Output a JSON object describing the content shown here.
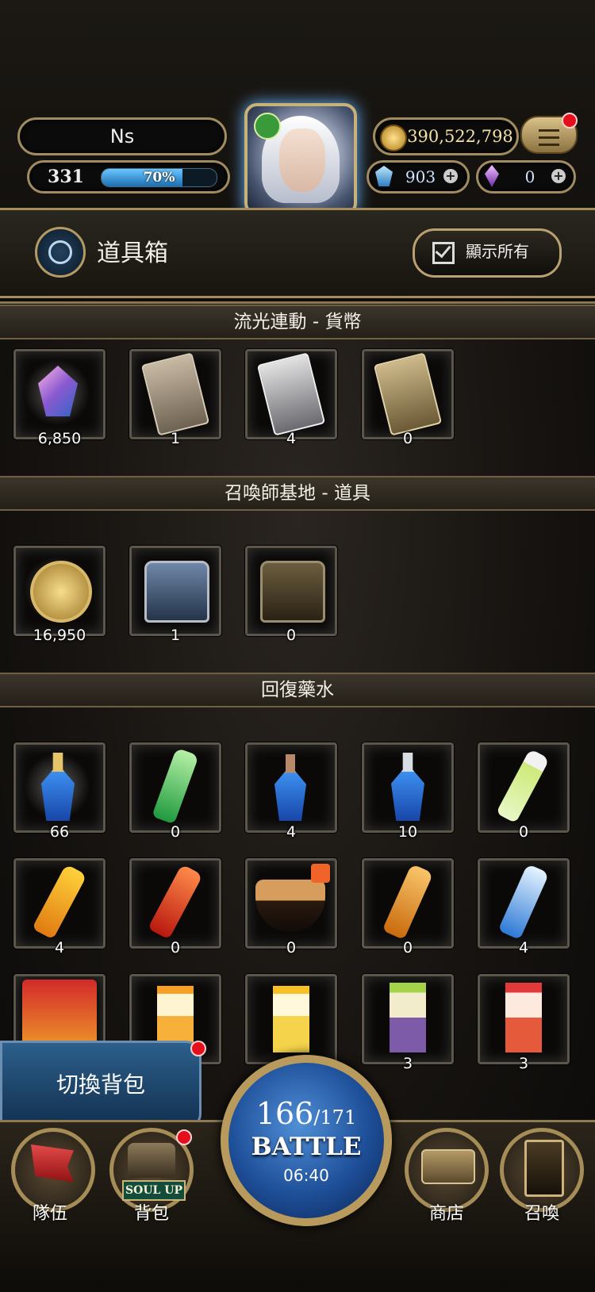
{
  "header": {
    "player_name": "Ns",
    "level": "331",
    "xp_percent_label": "70%",
    "xp_fraction": 0.7,
    "gold": "390,522,798",
    "gems": "903",
    "crystals": "0"
  },
  "item_box": {
    "title": "道具箱",
    "show_all_label": "顯示所有"
  },
  "sections": [
    {
      "title": "流光連動 - 貨幣",
      "items": [
        {
          "icon": "crystal-gem-icon",
          "count": "6,850"
        },
        {
          "icon": "bronze-card-icon",
          "count": "1"
        },
        {
          "icon": "silver-card-icon",
          "count": "4"
        },
        {
          "icon": "gold-card-icon",
          "count": "0"
        }
      ]
    },
    {
      "title": "召喚師基地 - 道具",
      "items": [
        {
          "icon": "gold-medal-icon",
          "count": "16,950"
        },
        {
          "icon": "blue-backpack-icon",
          "count": "1"
        },
        {
          "icon": "brown-backpack-icon",
          "count": "0"
        }
      ]
    },
    {
      "title": "回復藥水",
      "items": [
        {
          "icon": "gold-potion-icon",
          "count": "66"
        },
        {
          "icon": "green-soda-bottle-icon",
          "count": "0"
        },
        {
          "icon": "bronze-potion-icon",
          "count": "4"
        },
        {
          "icon": "silver-potion-icon",
          "count": "10"
        },
        {
          "icon": "green-tea-bottle-icon",
          "count": "0"
        },
        {
          "icon": "yellow-drink-bottle-icon",
          "count": "4"
        },
        {
          "icon": "red-drink-bottle-icon",
          "count": "0"
        },
        {
          "icon": "rice-bowl-icon",
          "count": "0"
        },
        {
          "icon": "orange-tea-bottle-icon",
          "count": "0"
        },
        {
          "icon": "water-bottle-icon",
          "count": "4"
        },
        {
          "icon": "snack-bag-icon",
          "count": ""
        },
        {
          "icon": "tea-carton-icon",
          "count": ""
        },
        {
          "icon": "tea-carton-icon",
          "count": ""
        },
        {
          "icon": "fruit-carton-icon",
          "count": "3"
        },
        {
          "icon": "apple-carton-icon",
          "count": "3"
        }
      ]
    }
  ],
  "switch_bag_label": "切換背包",
  "nav": {
    "team_label": "隊伍",
    "bag_label": "背包",
    "soul_up_label": "SOUL UP",
    "shop_label": "商店",
    "summon_label": "召喚"
  },
  "battle": {
    "stamina_current": "166",
    "stamina_max": "/171",
    "label": "BATTLE",
    "timer": "06:40"
  }
}
